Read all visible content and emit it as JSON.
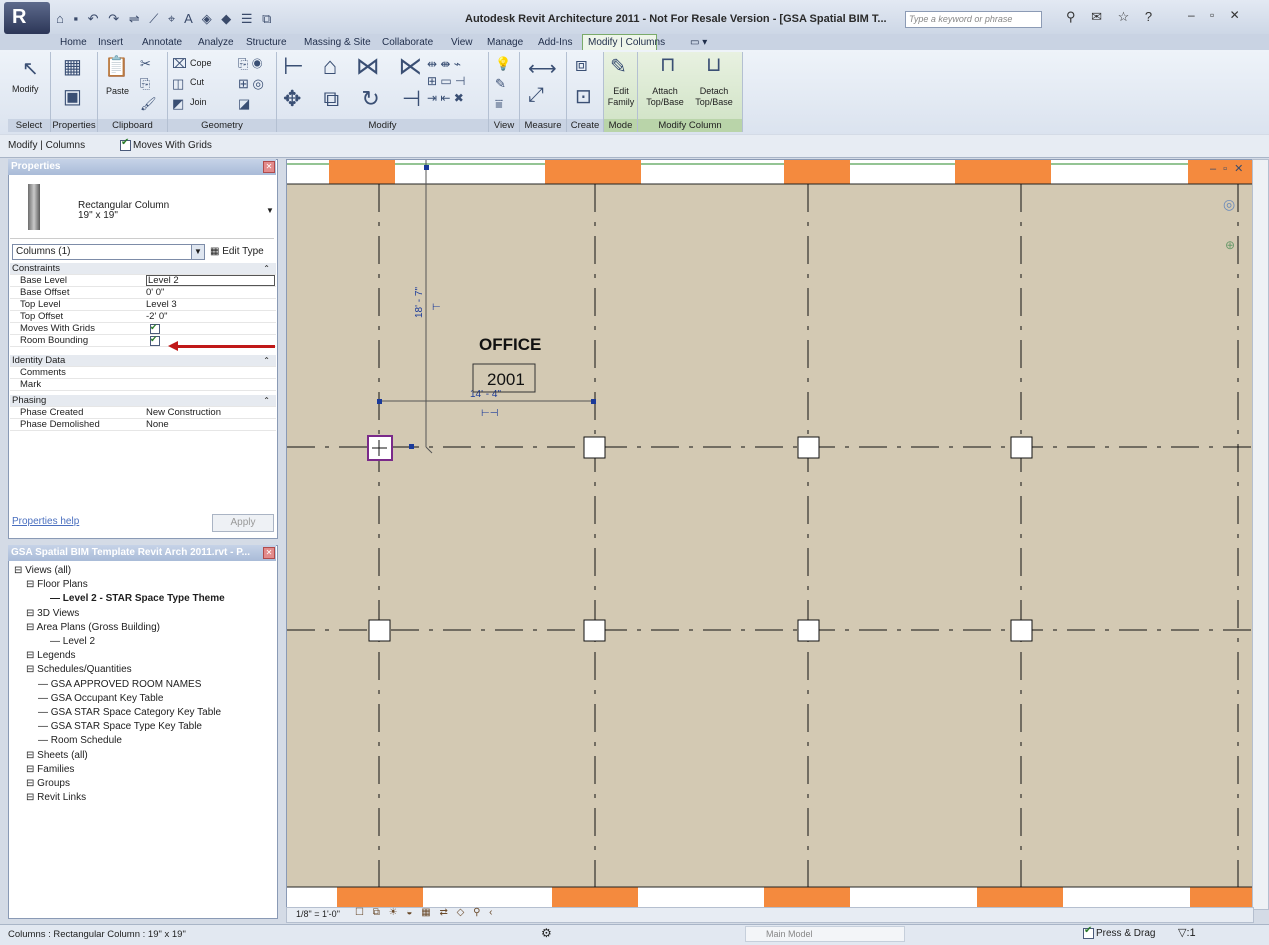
{
  "app": {
    "title": "Autodesk Revit Architecture 2011 - Not For Resale Version - [GSA Spatial BIM T...",
    "logo_letter": "R",
    "search_placeholder": "Type a keyword or phrase",
    "quick_access_icons": [
      "open-icon",
      "save-icon",
      "undo-icon",
      "redo-icon",
      "measure-icon",
      "dimension-icon",
      "tag-icon",
      "text-icon",
      "3d-view-icon",
      "section-icon",
      "close-hidden-icon",
      "switch-windows-icon"
    ],
    "window_controls": [
      "minimize",
      "restore",
      "close"
    ]
  },
  "ribbon": {
    "tabs": [
      "Home",
      "Insert",
      "Annotate",
      "Analyze",
      "Structure",
      "Massing & Site",
      "Collaborate",
      "View",
      "Manage",
      "Add-Ins",
      "Modify | Columns"
    ],
    "active_tab": "Modify | Columns",
    "panels": [
      {
        "label": "Select",
        "buttons": [
          "Modify"
        ]
      },
      {
        "label": "Properties",
        "buttons": []
      },
      {
        "label": "Clipboard",
        "buttons": [
          "Paste"
        ]
      },
      {
        "label": "Geometry",
        "buttons": [
          "Cope",
          "Cut",
          "Join"
        ]
      },
      {
        "label": "Modify",
        "buttons": []
      },
      {
        "label": "View",
        "buttons": []
      },
      {
        "label": "Measure",
        "buttons": []
      },
      {
        "label": "Create",
        "buttons": []
      },
      {
        "label": "Mode",
        "buttons": [
          "Edit Family"
        ]
      },
      {
        "label": "Modify Column",
        "buttons": [
          "Attach Top/Base",
          "Detach Top/Base"
        ]
      }
    ]
  },
  "options_bar": {
    "context": "Modify | Columns",
    "moves_with_grids_label": "Moves With Grids",
    "moves_with_grids": true
  },
  "properties": {
    "title": "Properties",
    "type_name": "Rectangular Column",
    "type_size": "19\" x 19\"",
    "instance_filter": "Columns (1)",
    "edit_type": "Edit Type",
    "groups": [
      {
        "name": "Constraints",
        "rows": [
          {
            "key": "Base Level",
            "value": "Level 2"
          },
          {
            "key": "Base Offset",
            "value": "0' 0\""
          },
          {
            "key": "Top Level",
            "value": "Level 3"
          },
          {
            "key": "Top Offset",
            "value": "-2' 0\""
          },
          {
            "key": "Moves With Grids",
            "value": "checked"
          },
          {
            "key": "Room Bounding",
            "value": "checked"
          }
        ]
      },
      {
        "name": "Identity Data",
        "rows": [
          {
            "key": "Comments",
            "value": ""
          },
          {
            "key": "Mark",
            "value": ""
          }
        ]
      },
      {
        "name": "Phasing",
        "rows": [
          {
            "key": "Phase Created",
            "value": "New Construction"
          },
          {
            "key": "Phase Demolished",
            "value": "None"
          }
        ]
      }
    ],
    "help": "Properties help",
    "apply": "Apply"
  },
  "browser": {
    "title": "GSA Spatial BIM Template Revit Arch 2011.rvt - P...",
    "items": [
      {
        "label": "Views (all)",
        "depth": 0
      },
      {
        "label": "Floor Plans",
        "depth": 1
      },
      {
        "label": "Level 2 - STAR Space Type Theme",
        "depth": 3,
        "bold": true
      },
      {
        "label": "3D Views",
        "depth": 1
      },
      {
        "label": "Area Plans (Gross Building)",
        "depth": 1
      },
      {
        "label": "Level 2",
        "depth": 3
      },
      {
        "label": "Legends",
        "depth": 1
      },
      {
        "label": "Schedules/Quantities",
        "depth": 1
      },
      {
        "label": "GSA APPROVED ROOM NAMES",
        "depth": 2
      },
      {
        "label": "GSA Occupant Key Table",
        "depth": 2
      },
      {
        "label": "GSA STAR Space Category Key Table",
        "depth": 2
      },
      {
        "label": "GSA STAR Space Type Key Table",
        "depth": 2
      },
      {
        "label": "Room Schedule",
        "depth": 2
      },
      {
        "label": "Sheets (all)",
        "depth": 1
      },
      {
        "label": "Families",
        "depth": 1
      },
      {
        "label": "Groups",
        "depth": 1
      },
      {
        "label": "Revit Links",
        "depth": 1
      }
    ]
  },
  "canvas": {
    "room_name": "OFFICE",
    "room_number": "2001",
    "dim_vertical": "18' - 7\"",
    "dim_horizontal": "14' - 4\"",
    "scale": "1/8\" = 1'-0\"",
    "colors": {
      "background": "#d3c9b3",
      "wall": "#f48a3e",
      "selection": "#7a2a8a",
      "dimension": "#1a3a9a"
    }
  },
  "status": {
    "text": "Columns : Rectangular Column : 19\" x 19\"",
    "model": "Main Model",
    "press_drag": "Press & Drag",
    "filter_count": ":1"
  }
}
